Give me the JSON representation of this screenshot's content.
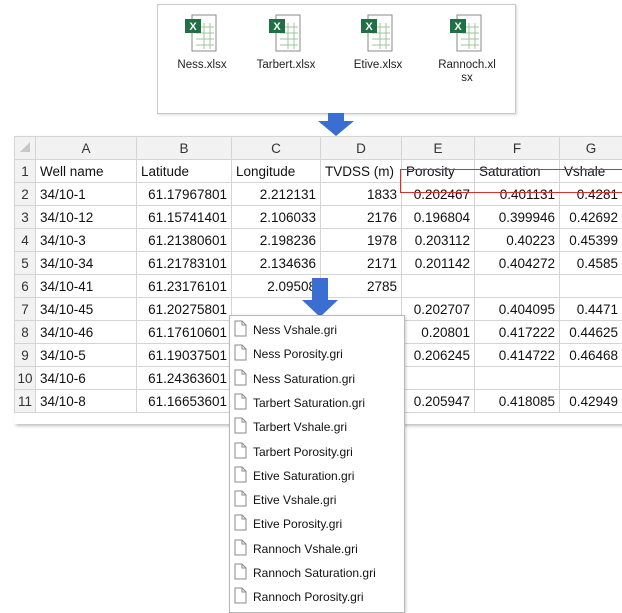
{
  "files": [
    {
      "name": "Ness.xlsx"
    },
    {
      "name": "Tarbert.xlsx"
    },
    {
      "name": "Etive.xlsx"
    },
    {
      "name": "Rannoch.xl\nsx"
    }
  ],
  "sheet": {
    "columns": [
      "A",
      "B",
      "C",
      "D",
      "E",
      "F",
      "G"
    ],
    "rows": [
      {
        "n": "1",
        "cells": [
          "Well name",
          "Latitude",
          "Longitude",
          "TVDSS (m)",
          "Porosity",
          "Saturation",
          "Vshale"
        ]
      },
      {
        "n": "2",
        "cells": [
          "34/10-1",
          "61.17967801",
          "2.212131",
          "1833",
          "0.202467",
          "0.401131",
          "0.4281"
        ]
      },
      {
        "n": "3",
        "cells": [
          "34/10-12",
          "61.15741401",
          "2.106033",
          "2176",
          "0.196804",
          "0.399946",
          "0.42692"
        ]
      },
      {
        "n": "4",
        "cells": [
          "34/10-3",
          "61.21380601",
          "2.198236",
          "1978",
          "0.203112",
          "0.40223",
          "0.45399"
        ]
      },
      {
        "n": "5",
        "cells": [
          "34/10-34",
          "61.21783101",
          "2.134636",
          "2171",
          "0.201142",
          "0.404272",
          "0.4585"
        ]
      },
      {
        "n": "6",
        "cells": [
          "34/10-41",
          "61.23176101",
          "2.09508",
          "2785",
          "",
          "",
          ""
        ]
      },
      {
        "n": "7",
        "cells": [
          "34/10-45",
          "61.20275801",
          "",
          "",
          "0.202707",
          "0.404095",
          "0.4471"
        ]
      },
      {
        "n": "8",
        "cells": [
          "34/10-46",
          "61.17610601",
          "",
          "",
          "0.20801",
          "0.417222",
          "0.44625"
        ]
      },
      {
        "n": "9",
        "cells": [
          "34/10-5",
          "61.19037501",
          "",
          "",
          "0.206245",
          "0.414722",
          "0.46468"
        ]
      },
      {
        "n": "10",
        "cells": [
          "34/10-6",
          "61.24363601",
          "",
          "",
          "",
          "",
          ""
        ]
      },
      {
        "n": "11",
        "cells": [
          "34/10-8",
          "61.16653601",
          "",
          "",
          "0.205947",
          "0.418085",
          "0.42949"
        ]
      }
    ]
  },
  "gri_files": [
    "Ness Vshale.gri",
    "Ness Porosity.gri",
    "Ness Saturation.gri",
    "Tarbert Saturation.gri",
    "Tarbert Vshale.gri",
    "Tarbert Porosity.gri",
    "Etive Saturation.gri",
    "Etive Vshale.gri",
    "Etive Porosity.gri",
    "Rannoch Vshale.gri",
    "Rannoch Saturation.gri",
    "Rannoch Porosity.gri"
  ],
  "colors": {
    "arrow": "#3a6ed0",
    "highlight_box": "#d9302c",
    "excel_green": "#1e7145"
  }
}
